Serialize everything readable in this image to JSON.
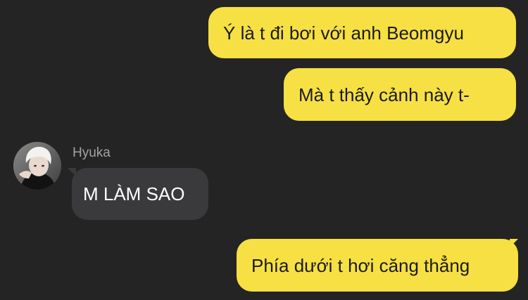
{
  "chat": {
    "messages": [
      {
        "sender": "me",
        "text": "Ý là t đi bơi với anh Beomgyu"
      },
      {
        "sender": "me",
        "text": "Mà t thấy cảnh này t-"
      },
      {
        "sender": "Hyuka",
        "text": "M LÀM SAO"
      },
      {
        "sender": "me",
        "text": "Phía dưới t hơi căng thẳng"
      }
    ],
    "contact": {
      "name": "Hyuka",
      "avatar_icon": "user-avatar"
    },
    "colors": {
      "background": "#242424",
      "outgoing_bubble": "#f7e043",
      "incoming_bubble": "#3a3a3c",
      "outgoing_text": "#1b1b1b",
      "incoming_text": "#ffffff",
      "sender_name": "#a3a3a3"
    }
  }
}
